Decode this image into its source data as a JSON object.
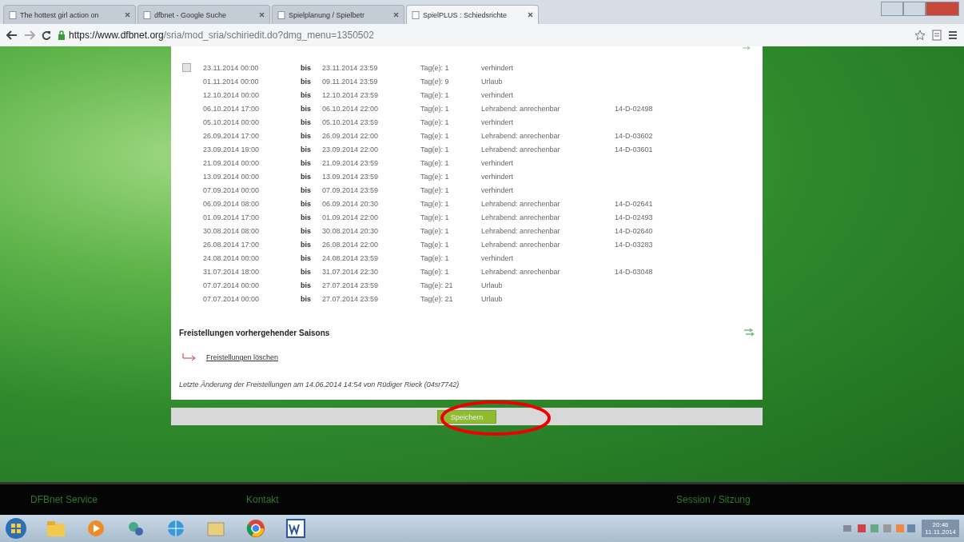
{
  "browser": {
    "tabs": [
      {
        "title": "The hottest girl action on",
        "selected": false
      },
      {
        "title": "dfbnet - Google Suche",
        "selected": false
      },
      {
        "title": "Spielplanung / Spielbetr",
        "selected": false
      },
      {
        "title": "SpielPLUS : Schiedsrichte",
        "selected": true
      }
    ],
    "url_host": "https://www.dfbnet.org",
    "url_path": "/sria/mod_sria/schiriedit.do?dmg_menu=1350502"
  },
  "rows": [
    {
      "selectable": true,
      "checked": false,
      "from": "23.11.2014 00:00",
      "bis": "bis",
      "to": "23.11.2014 23:59",
      "days": "Tag(e): 1",
      "reason": "verhindert",
      "number": ""
    },
    {
      "selectable": false,
      "from": "01.11.2014 00:00",
      "bis": "bis",
      "to": "09.11.2014 23:59",
      "days": "Tag(e): 9",
      "reason": "Urlaub",
      "number": ""
    },
    {
      "selectable": false,
      "from": "12.10.2014 00:00",
      "bis": "bis",
      "to": "12.10.2014 23:59",
      "days": "Tag(e): 1",
      "reason": "verhindert",
      "number": ""
    },
    {
      "selectable": false,
      "from": "06.10.2014 17:00",
      "bis": "bis",
      "to": "06.10.2014 22:00",
      "days": "Tag(e): 1",
      "reason": "Lehrabend: anrechenbar",
      "number": "14-D-02498"
    },
    {
      "selectable": false,
      "from": "05.10.2014 00:00",
      "bis": "bis",
      "to": "05.10.2014 23:59",
      "days": "Tag(e): 1",
      "reason": "verhindert",
      "number": ""
    },
    {
      "selectable": false,
      "from": "26.09.2014 17:00",
      "bis": "bis",
      "to": "26.09.2014 22:00",
      "days": "Tag(e): 1",
      "reason": "Lehrabend: anrechenbar",
      "number": "14-D-03602"
    },
    {
      "selectable": false,
      "from": "23.09.2014 19:00",
      "bis": "bis",
      "to": "23.09.2014 22:00",
      "days": "Tag(e): 1",
      "reason": "Lehrabend: anrechenbar",
      "number": "14-D-03601"
    },
    {
      "selectable": false,
      "from": "21.09.2014 00:00",
      "bis": "bis",
      "to": "21.09.2014 23:59",
      "days": "Tag(e): 1",
      "reason": "verhindert",
      "number": ""
    },
    {
      "selectable": false,
      "from": "13.09.2014 00:00",
      "bis": "bis",
      "to": "13.09.2014 23:59",
      "days": "Tag(e): 1",
      "reason": "verhindert",
      "number": ""
    },
    {
      "selectable": false,
      "from": "07.09.2014 00:00",
      "bis": "bis",
      "to": "07.09.2014 23:59",
      "days": "Tag(e): 1",
      "reason": "verhindert",
      "number": ""
    },
    {
      "selectable": false,
      "from": "06.09.2014 08:00",
      "bis": "bis",
      "to": "06.09.2014 20:30",
      "days": "Tag(e): 1",
      "reason": "Lehrabend: anrechenbar",
      "number": "14-D-02641"
    },
    {
      "selectable": false,
      "from": "01.09.2014 17:00",
      "bis": "bis",
      "to": "01.09.2014 22:00",
      "days": "Tag(e): 1",
      "reason": "Lehrabend: anrechenbar",
      "number": "14-D-02493"
    },
    {
      "selectable": false,
      "from": "30.08.2014 08:00",
      "bis": "bis",
      "to": "30.08.2014 20:30",
      "days": "Tag(e): 1",
      "reason": "Lehrabend: anrechenbar",
      "number": "14-D-02640"
    },
    {
      "selectable": false,
      "from": "26.08.2014 17:00",
      "bis": "bis",
      "to": "26.08.2014 22:00",
      "days": "Tag(e): 1",
      "reason": "Lehrabend: anrechenbar",
      "number": "14-D-03283"
    },
    {
      "selectable": false,
      "from": "24.08.2014 00:00",
      "bis": "bis",
      "to": "24.08.2014 23:59",
      "days": "Tag(e): 1",
      "reason": "verhindert",
      "number": ""
    },
    {
      "selectable": false,
      "from": "31.07.2014 18:00",
      "bis": "bis",
      "to": "31.07.2014 22:30",
      "days": "Tag(e): 1",
      "reason": "Lehrabend: anrechenbar",
      "number": "14-D-03048"
    },
    {
      "selectable": false,
      "from": "07.07.2014 00:00",
      "bis": "bis",
      "to": "27.07.2014 23:59",
      "days": "Tag(e): 21",
      "reason": "Urlaub",
      "number": ""
    },
    {
      "selectable": false,
      "from": "07.07.2014 00:00",
      "bis": "bis",
      "to": "27.07.2014 23:59",
      "days": "Tag(e): 21",
      "reason": "Urlaub",
      "number": ""
    }
  ],
  "previous_seasons": {
    "heading": "Freistellungen vorhergehender Saisons",
    "link": "Freistellungen löschen"
  },
  "last_change": "Letzte Änderung der Freistellungen am 14.06.2014 14:54 von Rüdiger Rieck (04sr7742)",
  "save_button": "Speichern",
  "footer": [
    "DFBnet Service",
    "Kontakt",
    "Session / Sitzung"
  ],
  "taskbar": {
    "time": "20:46",
    "date": "11.11.2014"
  }
}
